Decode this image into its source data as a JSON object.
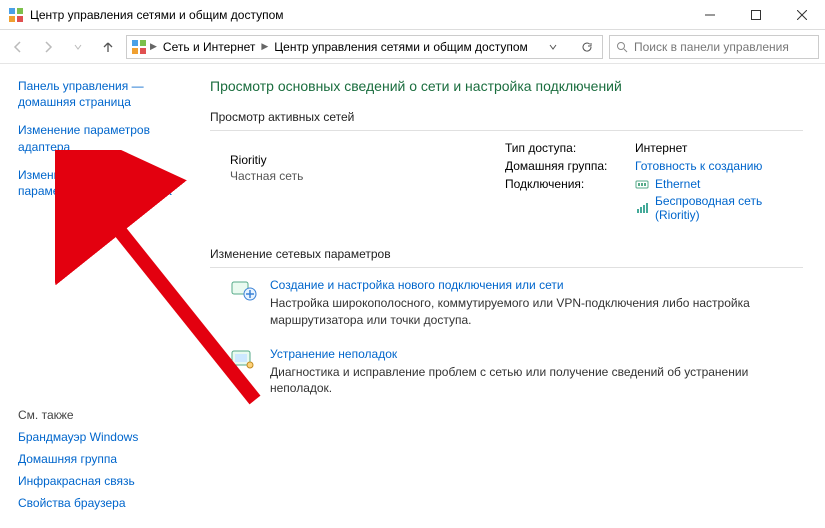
{
  "title": "Центр управления сетями и общим доступом",
  "breadcrumbs": [
    "Сеть и Интернет",
    "Центр управления сетями и общим доступом"
  ],
  "searchPlaceholder": "Поиск в панели управления",
  "sidebar": {
    "items": [
      "Панель управления — домашняя страница",
      "Изменение параметров адаптера",
      "Изменить дополнительные параметры общего доступа"
    ],
    "seeAlso": "См. также",
    "seeAlsoItems": [
      "Брандмауэр Windows",
      "Домашняя группа",
      "Инфракрасная связь",
      "Свойства браузера"
    ]
  },
  "main": {
    "heading": "Просмотр основных сведений о сети и настройка подключений",
    "activeNetworksTitle": "Просмотр активных сетей",
    "network": {
      "name": "Rioritiy",
      "type": "Частная сеть",
      "accessTypeLabel": "Тип доступа:",
      "accessTypeValue": "Интернет",
      "homegroupLabel": "Домашняя группа:",
      "homegroupValue": "Готовность к созданию",
      "connectionsLabel": "Подключения:",
      "conn1": "Ethernet",
      "conn2": "Беспроводная сеть (Rioritiy)"
    },
    "changeTitle": "Изменение сетевых параметров",
    "card1": {
      "title": "Создание и настройка нового подключения или сети",
      "desc": "Настройка широкополосного, коммутируемого или VPN-подключения либо настройка маршрутизатора или точки доступа."
    },
    "card2": {
      "title": "Устранение неполадок",
      "desc": "Диагностика и исправление проблем с сетью или получение сведений об устранении неполадок."
    }
  }
}
